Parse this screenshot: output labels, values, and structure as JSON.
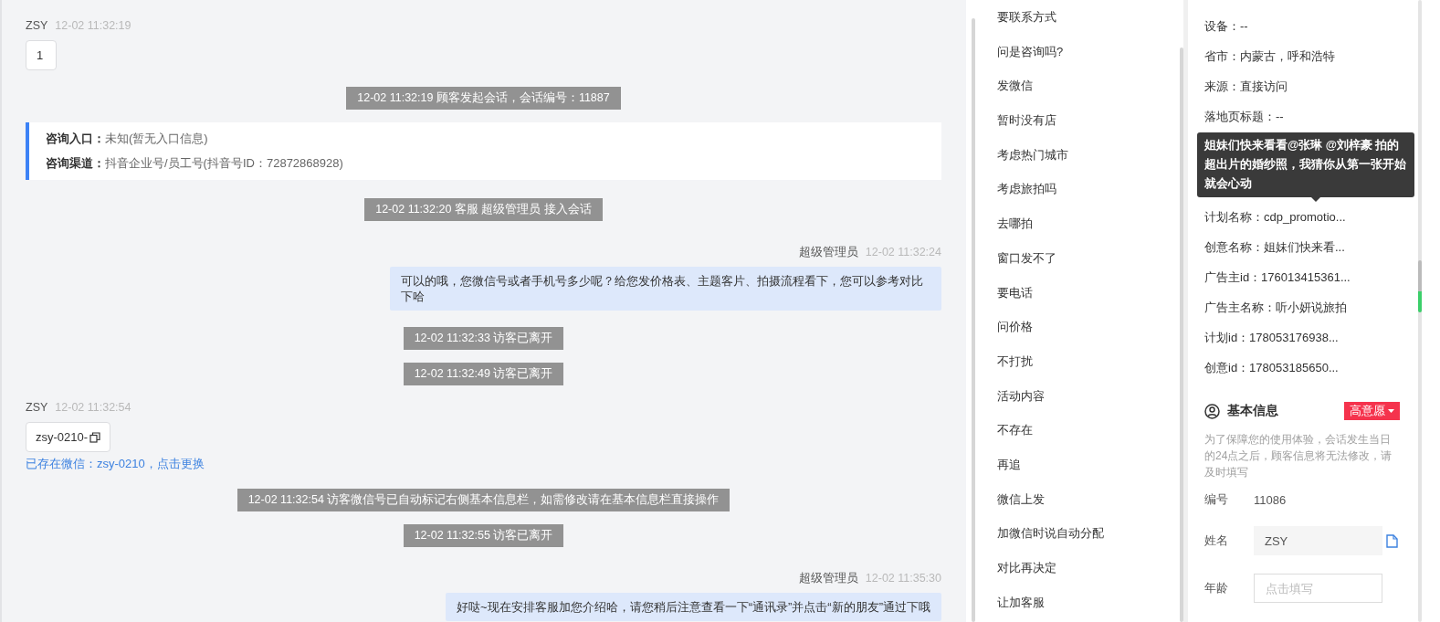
{
  "chat": {
    "messages": [
      {
        "kind": "customer",
        "name": "ZSY",
        "time": "12-02 11:32:19",
        "text": "1",
        "copyable": false
      },
      {
        "kind": "system",
        "text": "12-02 11:32:19 顾客发起会话，会话编号：11887"
      },
      {
        "kind": "entry",
        "rows": [
          {
            "label": "咨询入口：",
            "value": "未知(暂无入口信息)"
          },
          {
            "label": "咨询渠道：",
            "value": "抖音企业号/员工号(抖音号ID：72872868928)"
          }
        ]
      },
      {
        "kind": "system",
        "text": "12-02 11:32:20 客服 超级管理员 接入会话"
      },
      {
        "kind": "agent",
        "name": "超级管理员",
        "time": "12-02 11:32:24",
        "text": "可以的哦，您微信号或者手机号多少呢？给您发价格表、主题客片、拍摄流程看下，您可以参考对比下哈"
      },
      {
        "kind": "system",
        "text": "12-02 11:32:33 访客已离开"
      },
      {
        "kind": "system",
        "text": "12-02 11:32:49 访客已离开"
      },
      {
        "kind": "customer",
        "name": "ZSY",
        "time": "12-02 11:32:54",
        "text": "zsy-0210-",
        "copyable": true,
        "note": "已存在微信：zsy-0210，点击更换"
      },
      {
        "kind": "system",
        "text": "12-02 11:32:54 访客微信号已自动标记右侧基本信息栏，如需修改请在基本信息栏直接操作"
      },
      {
        "kind": "system",
        "text": "12-02 11:32:55 访客已离开"
      },
      {
        "kind": "agent",
        "name": "超级管理员",
        "time": "12-02 11:35:30",
        "text": "好哒~现在安排客服加您介绍哈，请您稍后注意查看一下“通讯录”并点击“新的朋友”通过下哦"
      }
    ]
  },
  "quick_replies": [
    "要联系方式",
    "问是咨询吗?",
    "发微信",
    "暂时没有店",
    "考虑热门城市",
    "考虑旅拍吗",
    "去哪拍",
    "窗口发不了",
    "要电话",
    "问价格",
    "不打扰",
    "活动内容",
    "不存在",
    "再追",
    "微信上发",
    "加微信时说自动分配",
    "对比再决定",
    "让加客服"
  ],
  "visitor_info": {
    "rows_before": [
      "设备：--",
      "省市：内蒙古，呼和浩特",
      "来源：直接访问",
      "落地页标题：--"
    ],
    "tooltip": "姐妹们快来看看@张琳 @刘梓豪 拍的超出片的婚纱照，我猜你从第一张开始就会心动",
    "rows_after": [
      "计划名称：cdp_promotio...",
      "创意名称：姐妹们快来看...",
      "广告主id：176013415361...",
      "广告主名称：听小妍说旅拍",
      "计划id：178053176938...",
      "创意id：178053185650..."
    ]
  },
  "basic_info": {
    "title": "基本信息",
    "intent_tag": "高意愿",
    "notice": "为了保障您的使用体验，会话发生当日的24点之后，顾客信息将无法修改，请及时填写",
    "fields": [
      {
        "kind": "text",
        "label": "编号",
        "value": "11086"
      },
      {
        "kind": "filled",
        "label": "姓名",
        "value": "ZSY"
      },
      {
        "kind": "input",
        "label": "年龄",
        "placeholder": "点击填写"
      }
    ]
  }
}
